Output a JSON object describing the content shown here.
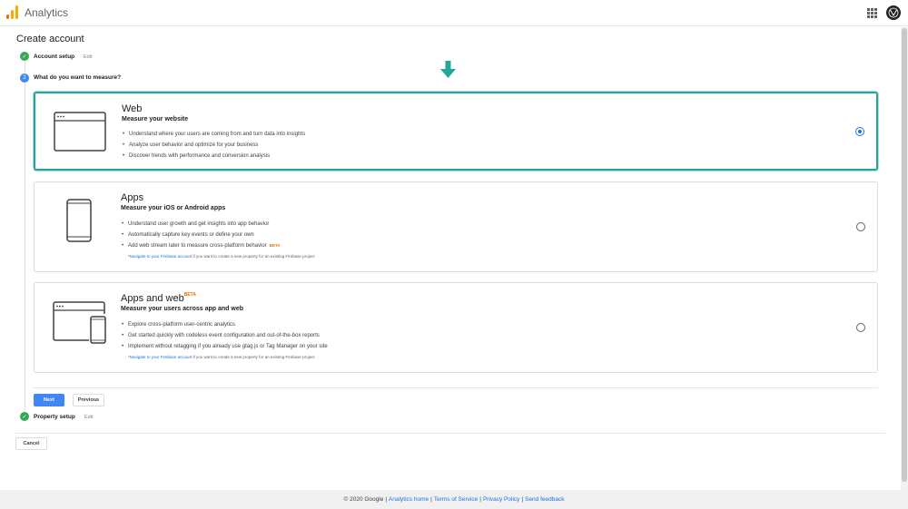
{
  "header": {
    "app_title": "Analytics",
    "brand_colors": [
      "#f9ab00",
      "#e37400"
    ]
  },
  "page": {
    "title": "Create account"
  },
  "steps": {
    "account_setup": {
      "label": "Account setup",
      "edit": "Edit"
    },
    "measure": {
      "number": "2",
      "label": "What do you want to measure?"
    },
    "property_setup": {
      "label": "Property setup",
      "edit": "Edit"
    }
  },
  "cards": {
    "web": {
      "title": "Web",
      "subtitle": "Measure your website",
      "bullets": [
        "Understand where your users are coming from and turn data into insights",
        "Analyze user behavior and optimize for your business",
        "Discover trends with performance and conversion analysis"
      ],
      "selected": true
    },
    "apps": {
      "title": "Apps",
      "subtitle": "Measure your iOS or Android apps",
      "bullets": [
        "Understand user growth and get insights into app behavior",
        "Automatically capture key events or define your own",
        "Add web stream later to measure cross-platform behavior"
      ],
      "bullet_badge": "BETA",
      "note_link": "*Navigate to your Firebase account",
      "note_text": " if you want to create a new property for an existing Firebase project",
      "selected": false
    },
    "apps_web": {
      "title": "Apps and web",
      "title_badge": "BETA",
      "subtitle": "Measure your users across app and web",
      "bullets": [
        "Explore cross-platform user-centric analytics",
        "Get started quickly with codeless event configuration and out-of-the-box reports",
        "Implement without retagging if you already use gtag.js or Tag Manager on your site"
      ],
      "note_link": "*Navigate to your Firebase account",
      "note_text": " if you want to create a new property for an existing Firebase project",
      "selected": false
    }
  },
  "buttons": {
    "next": "Next",
    "previous": "Previous",
    "cancel": "Cancel"
  },
  "footer": {
    "copyright": "© 2020 Google",
    "links": [
      "Analytics home",
      "Terms of Service",
      "Privacy Policy",
      "Send feedback"
    ],
    "separator": "|"
  },
  "colors": {
    "accent": "#4285f4",
    "selected_border": "#26a69a",
    "done": "#34a853",
    "beta": "#e8710a",
    "arrow": "#26a69a"
  }
}
